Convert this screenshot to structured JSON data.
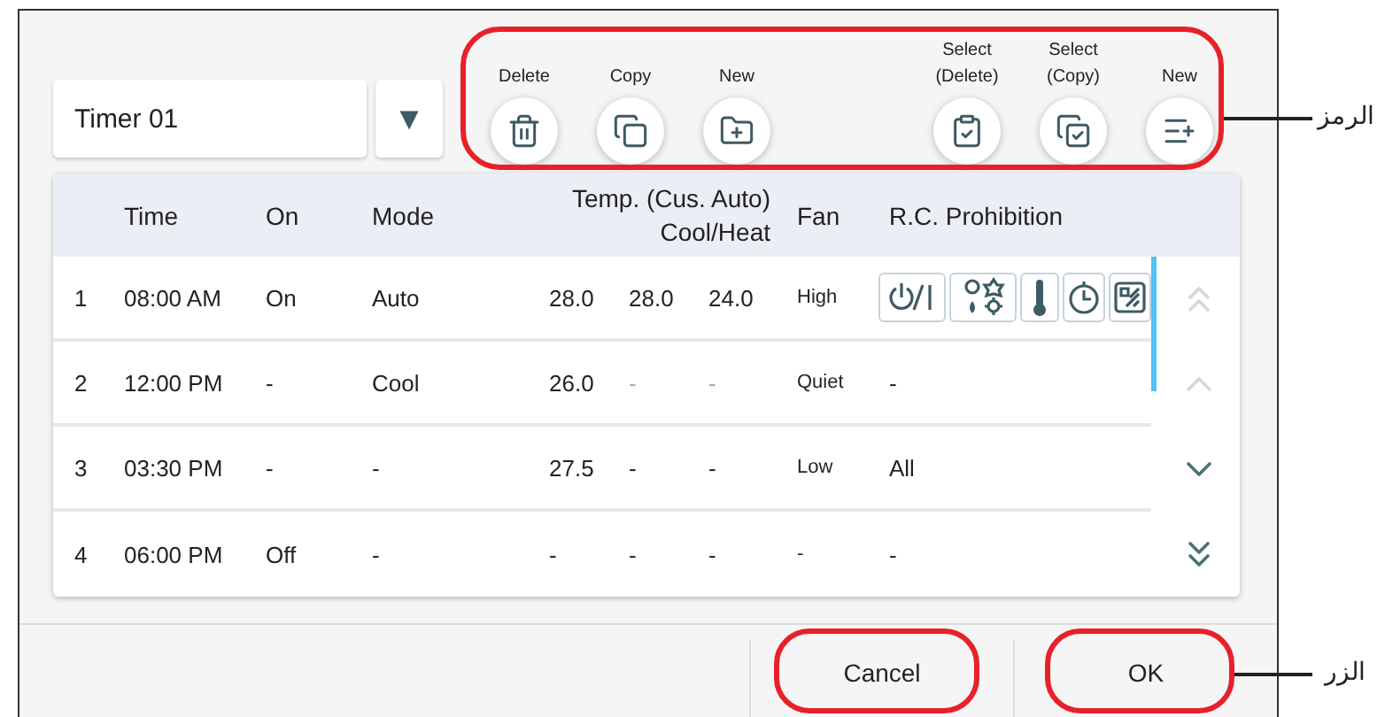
{
  "timer_select": {
    "value": "Timer 01",
    "arrow": "▼"
  },
  "toolbar_groups": [
    [
      {
        "label": "Delete",
        "kind": "trash"
      },
      {
        "label": "Copy",
        "kind": "copy"
      },
      {
        "label": "New",
        "kind": "folder-plus"
      }
    ],
    [
      {
        "label": "Select\n(Delete)",
        "kind": "clipboard-check"
      },
      {
        "label": "Select\n(Copy)",
        "kind": "copy-check"
      },
      {
        "label": "New",
        "kind": "list-plus"
      }
    ]
  ],
  "table": {
    "columns": {
      "time": "Time",
      "on": "On",
      "mode": "Mode",
      "temp": "Temp. (Cus. Auto)",
      "temp_sub": "Cool/Heat",
      "fan": "Fan",
      "prohibition": "R.C. Prohibition"
    },
    "rows": [
      {
        "number": "1",
        "time": "08:00 AM",
        "on": "On",
        "mode": "Auto",
        "temps": [
          {
            "value": "28.0",
            "disabled": false
          },
          {
            "value": "28.0",
            "disabled": false
          },
          {
            "value": "24.0",
            "disabled": false
          }
        ],
        "fan": "High",
        "prohibition": {
          "kind": "icons"
        }
      },
      {
        "number": "2",
        "time": "12:00 PM",
        "on": "-",
        "mode": "Cool",
        "temps": [
          {
            "value": "26.0",
            "disabled": false
          },
          {
            "value": "-",
            "disabled": true
          },
          {
            "value": "-",
            "disabled": true
          }
        ],
        "fan": "Quiet",
        "prohibition": {
          "kind": "text",
          "text": "-"
        }
      },
      {
        "number": "3",
        "time": "03:30 PM",
        "on": "-",
        "mode": "-",
        "temps": [
          {
            "value": "27.5",
            "disabled": false
          },
          {
            "value": "-",
            "disabled": false
          },
          {
            "value": "-",
            "disabled": false
          }
        ],
        "fan": "Low",
        "prohibition": {
          "kind": "text",
          "text": "All"
        }
      },
      {
        "number": "4",
        "time": "06:00 PM",
        "on": "Off",
        "mode": "-",
        "temps": [
          {
            "value": "-",
            "disabled": false
          },
          {
            "value": "-",
            "disabled": false
          },
          {
            "value": "-",
            "disabled": false
          }
        ],
        "fan": "-",
        "prohibition": {
          "kind": "text",
          "text": "-"
        }
      }
    ]
  },
  "scroll_buttons": [
    {
      "kind": "top",
      "disabled": true
    },
    {
      "kind": "up",
      "disabled": true
    },
    {
      "kind": "down",
      "disabled": false
    },
    {
      "kind": "bottom",
      "disabled": false
    }
  ],
  "footer_buttons": [
    "Cancel",
    "OK"
  ],
  "annotations": {
    "toolbar": {
      "label": "الرمز"
    },
    "buttons": {
      "label": "الزر"
    }
  }
}
